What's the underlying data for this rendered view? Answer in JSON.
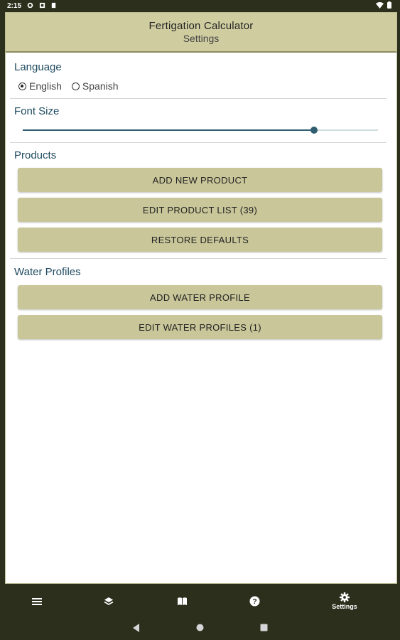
{
  "status_bar": {
    "time": "2:15"
  },
  "app_bar": {
    "title": "Fertigation Calculator",
    "subtitle": "Settings"
  },
  "language": {
    "title": "Language",
    "options": [
      {
        "label": "English",
        "selected": true
      },
      {
        "label": "Spanish",
        "selected": false
      }
    ]
  },
  "font_size": {
    "title": "Font Size",
    "slider_fraction": 0.82
  },
  "products": {
    "title": "Products",
    "buttons": [
      "ADD NEW PRODUCT",
      "EDIT PRODUCT LIST (39)",
      "RESTORE DEFAULTS"
    ]
  },
  "water_profiles": {
    "title": "Water Profiles",
    "buttons": [
      "ADD WATER PROFILE",
      "EDIT WATER PROFILES (1)"
    ]
  },
  "bottom_nav": {
    "items": [
      {
        "icon": "menu-icon",
        "label": ""
      },
      {
        "icon": "layers-icon",
        "label": ""
      },
      {
        "icon": "book-icon",
        "label": ""
      },
      {
        "icon": "help-icon",
        "label": ""
      },
      {
        "icon": "gear-icon",
        "label": "Settings"
      }
    ]
  },
  "colors": {
    "accent": "#cfcda0",
    "button": "#c9c79a",
    "section_title": "#1e4a5f",
    "chrome": "#2c2f1c"
  }
}
